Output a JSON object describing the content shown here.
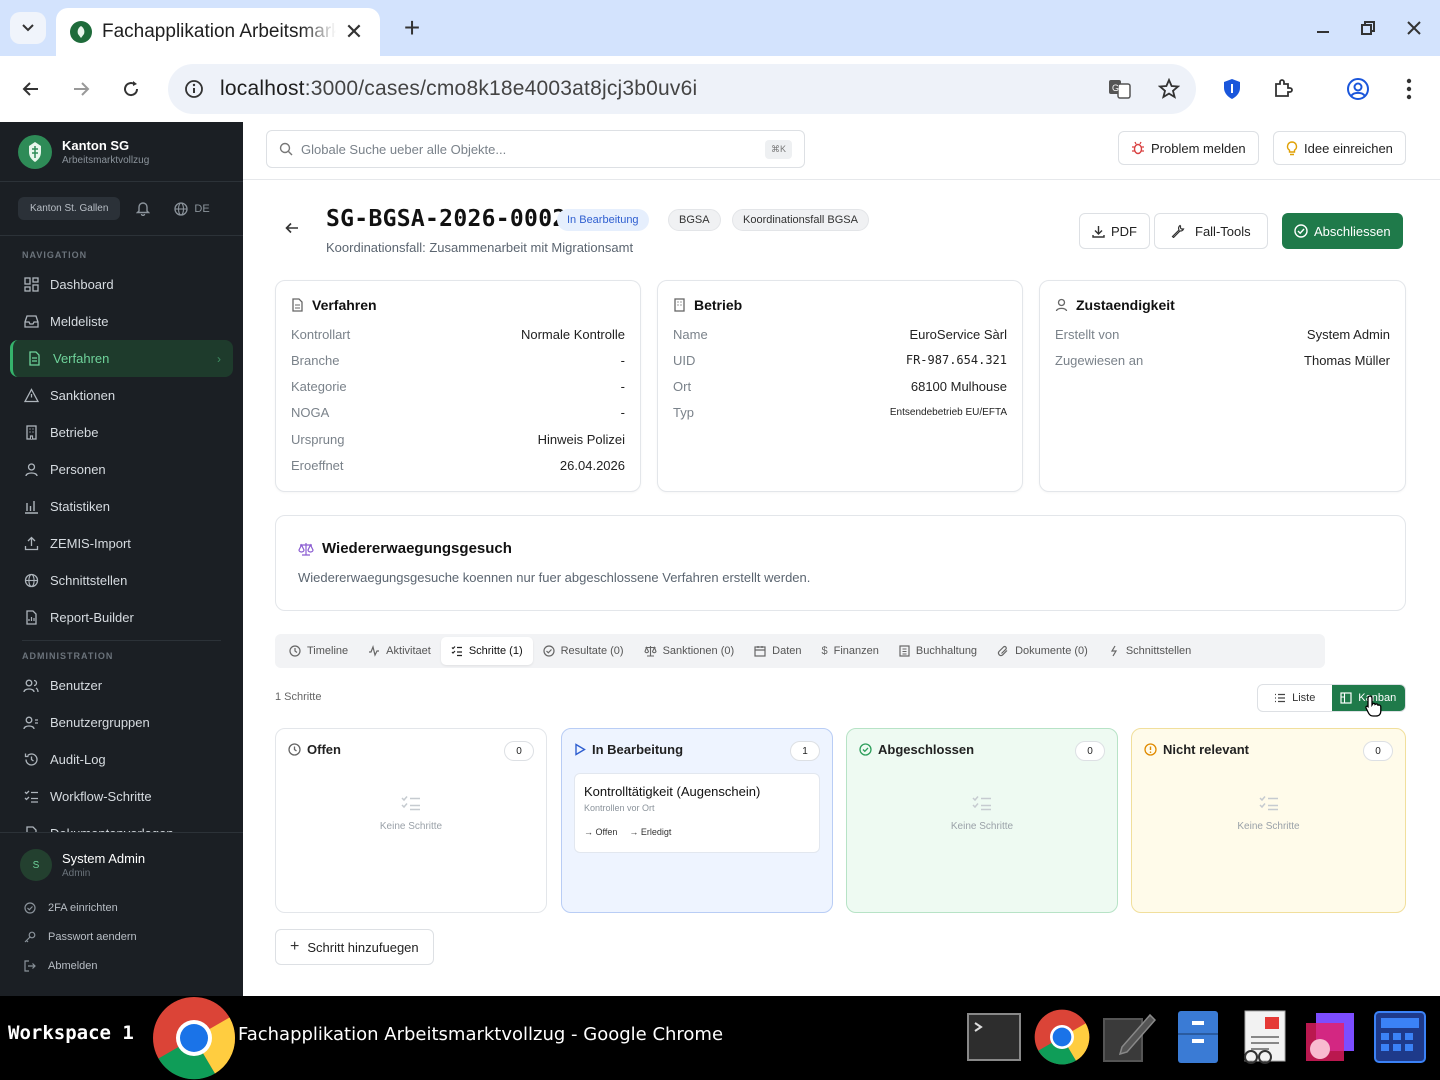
{
  "browser": {
    "tab_title": "Fachapplikation Arbeitsmarktvollzug",
    "url_host": "localhost",
    "url_path": ":3000/cases/cmo8k18e4003at8jcj3b0uv6i"
  },
  "sidebar": {
    "brand_name": "Kanton SG",
    "brand_sub": "Arbeitsmarktvollzug",
    "canton": "Kanton St. Gallen",
    "lang": "DE",
    "nav_section": "NAVIGATION",
    "nav_items": [
      "Dashboard",
      "Meldeliste",
      "Verfahren",
      "Sanktionen",
      "Betriebe",
      "Personen",
      "Statistiken",
      "ZEMIS-Import",
      "Schnittstellen",
      "Report-Builder"
    ],
    "admin_section": "ADMINISTRATION",
    "admin_items": [
      "Benutzer",
      "Benutzergruppen",
      "Audit-Log",
      "Workflow-Schritte",
      "Dokumentenvorlagen"
    ],
    "user_initial": "S",
    "user_name": "System Admin",
    "user_role": "Admin",
    "footer_items": [
      "2FA einrichten",
      "Passwort aendern",
      "Abmelden"
    ]
  },
  "topbar": {
    "search_placeholder": "Globale Suche ueber alle Objekte...",
    "search_kbd": "⌘K",
    "report_problem": "Problem melden",
    "submit_idea": "Idee einreichen"
  },
  "case": {
    "id": "SG-BGSA-2026-0002",
    "status": "In Bearbeitung",
    "tag1": "BGSA",
    "tag2": "Koordinationsfall BGSA",
    "subtitle": "Koordinationsfall: Zusammenarbeit mit Migrationsamt",
    "pdf": "PDF",
    "tools": "Fall-Tools",
    "close": "Abschliessen"
  },
  "cards": {
    "verfahren": {
      "title": "Verfahren",
      "rows": [
        {
          "k": "Kontrollart",
          "v": "Normale Kontrolle"
        },
        {
          "k": "Branche",
          "v": "-"
        },
        {
          "k": "Kategorie",
          "v": "-"
        },
        {
          "k": "NOGA",
          "v": "-"
        },
        {
          "k": "Ursprung",
          "v": "Hinweis Polizei"
        },
        {
          "k": "Eroeffnet",
          "v": "26.04.2026"
        }
      ]
    },
    "betrieb": {
      "title": "Betrieb",
      "rows": [
        {
          "k": "Name",
          "v": "EuroService Sàrl"
        },
        {
          "k": "UID",
          "v": "FR-987.654.321"
        },
        {
          "k": "Ort",
          "v": "68100 Mulhouse"
        },
        {
          "k": "Typ",
          "v": "Entsendebetrieb EU/EFTA"
        }
      ]
    },
    "zustaendigkeit": {
      "title": "Zustaendigkeit",
      "rows": [
        {
          "k": "Erstellt von",
          "v": "System Admin"
        },
        {
          "k": "Zugewiesen an",
          "v": "Thomas Müller"
        }
      ]
    }
  },
  "reconsideration": {
    "title": "Wiedererwaegungsgesuch",
    "text": "Wiedererwaegungsgesuche koennen nur fuer abgeschlossene Verfahren erstellt werden."
  },
  "tabs": [
    "Timeline",
    "Aktivitaet",
    "Schritte (1)",
    "Resultate (0)",
    "Sanktionen (0)",
    "Daten",
    "Finanzen",
    "Buchhaltung",
    "Dokumente (0)",
    "Schnittstellen"
  ],
  "steps": {
    "count_label": "1 Schritte",
    "view_list": "Liste",
    "view_kanban": "Kanban",
    "columns": [
      {
        "title": "Offen",
        "count": "0",
        "empty": "Keine Schritte",
        "color": "#ffffff",
        "border": "#e3e6ea",
        "icon_color": "#666666"
      },
      {
        "title": "In Bearbeitung",
        "count": "1",
        "empty": "",
        "color": "#eef4ff",
        "border": "#b9cdf5",
        "icon_color": "#2f5fd0"
      },
      {
        "title": "Abgeschlossen",
        "count": "0",
        "empty": "Keine Schritte",
        "color": "#eefaf2",
        "border": "#b7e3c6",
        "icon_color": "#2e9e5b"
      },
      {
        "title": "Nicht relevant",
        "count": "0",
        "empty": "Keine Schritte",
        "color": "#fffbea",
        "border": "#f1df9c",
        "icon_color": "#e08a00"
      }
    ],
    "card_title": "Kontrolltätigkeit (Augenschein)",
    "card_sub": "Kontrollen vor Ort",
    "card_action1": "→ Offen",
    "card_action2": "→ Erledigt",
    "add_step": "Schritt hinzufuegen"
  },
  "taskbar": {
    "workspace": "Workspace 1",
    "window_title": "Fachapplikation Arbeitsmarktvollzug - Google Chrome"
  }
}
